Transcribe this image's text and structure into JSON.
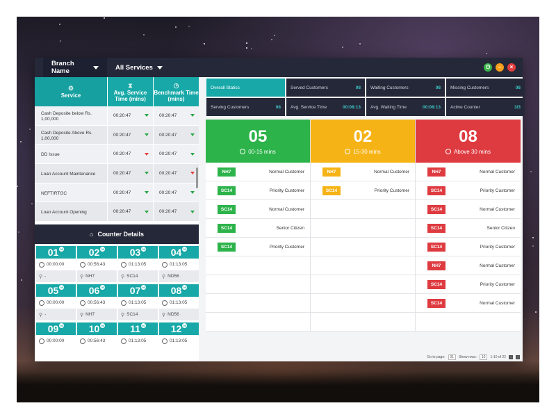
{
  "topbar": {
    "branch_label": "Branch Name",
    "services_label": "All Services",
    "controls": {
      "power_icon": "power-icon",
      "minimize_icon": "minimize-icon",
      "close_icon": "close-icon"
    }
  },
  "service_table": {
    "headers": {
      "service": "Service",
      "avg_time": "Avg. Service Time (mins)",
      "benchmark_time": "Benchmark Time (mins)"
    },
    "rows": [
      {
        "name": "Cash Deposite below Rs. 1,00,000",
        "avg": "00:20:47",
        "avg_status": "green",
        "bench": "00:20:47",
        "bench_status": "green"
      },
      {
        "name": "Cash Deposite Above Rs. 1,00,000",
        "avg": "00:20:47",
        "avg_status": "green",
        "bench": "00:20:47",
        "bench_status": "green"
      },
      {
        "name": "DD Issue",
        "avg": "00:20:47",
        "avg_status": "red",
        "bench": "00:20:47",
        "bench_status": "green"
      },
      {
        "name": "Loan Account Maintenance",
        "avg": "00:20:47",
        "avg_status": "green",
        "bench": "00:20:47",
        "bench_status": "red"
      },
      {
        "name": "NEFT/RTGC",
        "avg": "00:20:47",
        "avg_status": "green",
        "bench": "00:20:47",
        "bench_status": "green"
      },
      {
        "name": "Loan Account Opening",
        "avg": "00:20:47",
        "avg_status": "green",
        "bench": "00:20:47",
        "bench_status": "green"
      }
    ]
  },
  "counter_details": {
    "title": "Counter Details",
    "counters": [
      {
        "num": "01",
        "badge": "00",
        "time": "00:00:00",
        "user": "-"
      },
      {
        "num": "02",
        "badge": "00",
        "time": "00:56:43",
        "user": "NH7"
      },
      {
        "num": "03",
        "badge": "00",
        "time": "01:13:05",
        "user": "SC14"
      },
      {
        "num": "04",
        "badge": "00",
        "time": "01:13:05",
        "user": "ND56"
      },
      {
        "num": "05",
        "badge": "00",
        "time": "00:00:00",
        "user": "-"
      },
      {
        "num": "06",
        "badge": "00",
        "time": "00:56:43",
        "user": "NH7"
      },
      {
        "num": "07",
        "badge": "00",
        "time": "01:13:05",
        "user": "SC14"
      },
      {
        "num": "08",
        "badge": "05",
        "time": "01:13:05",
        "user": "ND56"
      },
      {
        "num": "09",
        "badge": "00",
        "time": "00:00:00",
        "user": ""
      },
      {
        "num": "10",
        "badge": "00",
        "time": "00:56:43",
        "user": ""
      },
      {
        "num": "11",
        "badge": "00",
        "time": "01:13:05",
        "user": ""
      },
      {
        "num": "12",
        "badge": "05",
        "time": "01:13:05",
        "user": ""
      }
    ]
  },
  "stats": [
    {
      "label": "Overall Statics",
      "value": ""
    },
    {
      "label": "Served Customers",
      "value": "08"
    },
    {
      "label": "Waiting Customers",
      "value": "08"
    },
    {
      "label": "Missing Customers",
      "value": "08"
    },
    {
      "label": "Serving Customers",
      "value": "08"
    },
    {
      "label": "Avg. Service Time",
      "value": "00:08:13"
    },
    {
      "label": "Avg. Waiting Time",
      "value": "00:08:13"
    },
    {
      "label": "Active Counter",
      "value": "3/3"
    }
  ],
  "queues": [
    {
      "count": "05",
      "range": "00-15 mins",
      "color": "#2cb34a",
      "items": [
        {
          "tag": "NH7",
          "type": "Normal Customer"
        },
        {
          "tag": "SC14",
          "type": "Priority Customer"
        },
        {
          "tag": "SC14",
          "type": "Normal Customer"
        },
        {
          "tag": "SC14",
          "type": "Senior Citizen"
        },
        {
          "tag": "SC14",
          "type": "Priority Customer"
        }
      ]
    },
    {
      "count": "02",
      "range": "15-30 mins",
      "color": "#f6b315",
      "items": [
        {
          "tag": "NH7",
          "type": "Normal Customer"
        },
        {
          "tag": "SC14",
          "type": "Priority Customer"
        }
      ]
    },
    {
      "count": "08",
      "range": "Above 30 mins",
      "color": "#de3b40",
      "items": [
        {
          "tag": "NH7",
          "type": "Normal Customer"
        },
        {
          "tag": "SC14",
          "type": "Priority Customer"
        },
        {
          "tag": "SC14",
          "type": "Normal Customer"
        },
        {
          "tag": "SC14",
          "type": "Senior Citizen"
        },
        {
          "tag": "SC14",
          "type": "Priority Customer"
        },
        {
          "tag": "NH7",
          "type": "Normal Customer"
        },
        {
          "tag": "SC14",
          "type": "Priority Customer"
        },
        {
          "tag": "SC14",
          "type": "Normal Customer"
        }
      ]
    }
  ],
  "pager": {
    "go_to_label": "Go to page:",
    "page": "01",
    "rows_label": "Show rows:",
    "rows": "10",
    "range": "1-10 of 22"
  }
}
